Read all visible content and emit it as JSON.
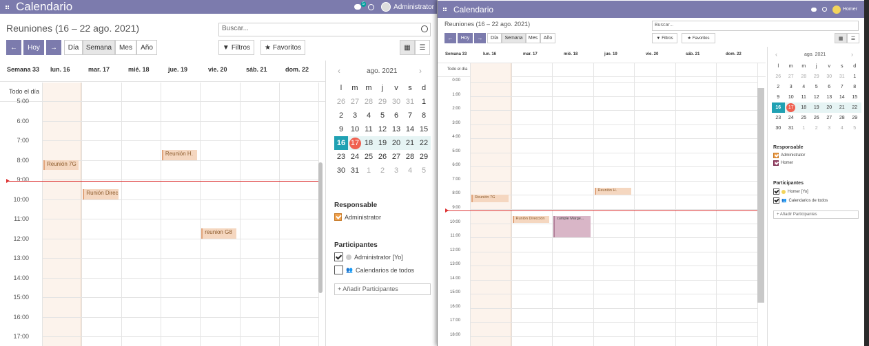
{
  "app_title": "Calendario",
  "breadcrumb": "Reuniones (16 – 22 ago. 2021)",
  "search_placeholder": "Buscar...",
  "nav_today": "Hoy",
  "nav_prev": "←",
  "nav_next": "→",
  "views": [
    "Día",
    "Semana",
    "Mes",
    "Año"
  ],
  "active_view": "Semana",
  "filters_label": "Filtros",
  "favorites_label": "Favoritos",
  "user_main": "Administrator",
  "user_second": "Homer",
  "chat_badge": "5",
  "week_label": "Semana 33",
  "day_headers": [
    "lun. 16",
    "mar. 17",
    "mié. 18",
    "jue. 19",
    "vie. 20",
    "sáb. 21",
    "dom. 22"
  ],
  "all_day_label": "Todo el día",
  "hours_main": [
    "5:00",
    "6:00",
    "7:00",
    "8:00",
    "9:00",
    "10:00",
    "11:00",
    "12:00",
    "13:00",
    "14:00",
    "15:00",
    "16:00",
    "17:00"
  ],
  "hours_second": [
    "0:00",
    "1:00",
    "2:00",
    "3:00",
    "4:00",
    "5:00",
    "6:00",
    "7:00",
    "8:00",
    "9:00",
    "10:00",
    "11:00",
    "12:00",
    "13:00",
    "14:00",
    "15:00",
    "16:00",
    "17:00",
    "18:00"
  ],
  "events": [
    {
      "title": "Reunión 7G",
      "day": 0,
      "start": 8.0,
      "end": 8.5,
      "color": "orange"
    },
    {
      "title": "Reunión H.",
      "day": 3,
      "start": 7.5,
      "end": 8.0,
      "color": "orange"
    },
    {
      "title": "Runión Direc",
      "day": 1,
      "start": 9.5,
      "end": 10.0,
      "color": "orange"
    },
    {
      "title": "reunion G8",
      "day": 4,
      "start": 11.5,
      "end": 12.0,
      "color": "orange"
    }
  ],
  "events_second": [
    {
      "title": "Reunión 7G",
      "day": 0,
      "start": 8.0,
      "end": 8.5,
      "color": "orange"
    },
    {
      "title": "Reunión H.",
      "day": 3,
      "start": 7.5,
      "end": 8.0,
      "color": "orange"
    },
    {
      "title": "Runión Dirección",
      "day": 1,
      "start": 9.5,
      "end": 10.0,
      "color": "orange"
    },
    {
      "title": "cumple Marge...",
      "day": 2,
      "start": 9.5,
      "end": 11.0,
      "color": "purple"
    }
  ],
  "mini_month": "ago. 2021",
  "mini_prev": "‹",
  "mini_next": "›",
  "mini_weekdays": [
    "l",
    "m",
    "m",
    "j",
    "v",
    "s",
    "d"
  ],
  "mini_weeks": [
    [
      "26",
      "27",
      "28",
      "29",
      "30",
      "31",
      "1"
    ],
    [
      "2",
      "3",
      "4",
      "5",
      "6",
      "7",
      "8"
    ],
    [
      "9",
      "10",
      "11",
      "12",
      "13",
      "14",
      "15"
    ],
    [
      "16",
      "17",
      "18",
      "19",
      "20",
      "21",
      "22"
    ],
    [
      "23",
      "24",
      "25",
      "26",
      "27",
      "28",
      "29"
    ],
    [
      "30",
      "31",
      "1",
      "2",
      "3",
      "4",
      "5"
    ]
  ],
  "responsible_title": "Responsable",
  "responsible_main": [
    "Administrator"
  ],
  "responsible_second": [
    "Administrator",
    "Homer"
  ],
  "participants_title": "Participantes",
  "participants_main": [
    "Administrator [Yo]",
    "Calendarios de todos"
  ],
  "participants_second": [
    "Homer [Yo]",
    "Calendarios de todos"
  ],
  "add_participants": "+ Añadir Participantes",
  "colors": {
    "navbar": "#7c7bad",
    "accent": "#20a1b3",
    "today_marker": "#f06050",
    "now_line": "#dd3333"
  }
}
